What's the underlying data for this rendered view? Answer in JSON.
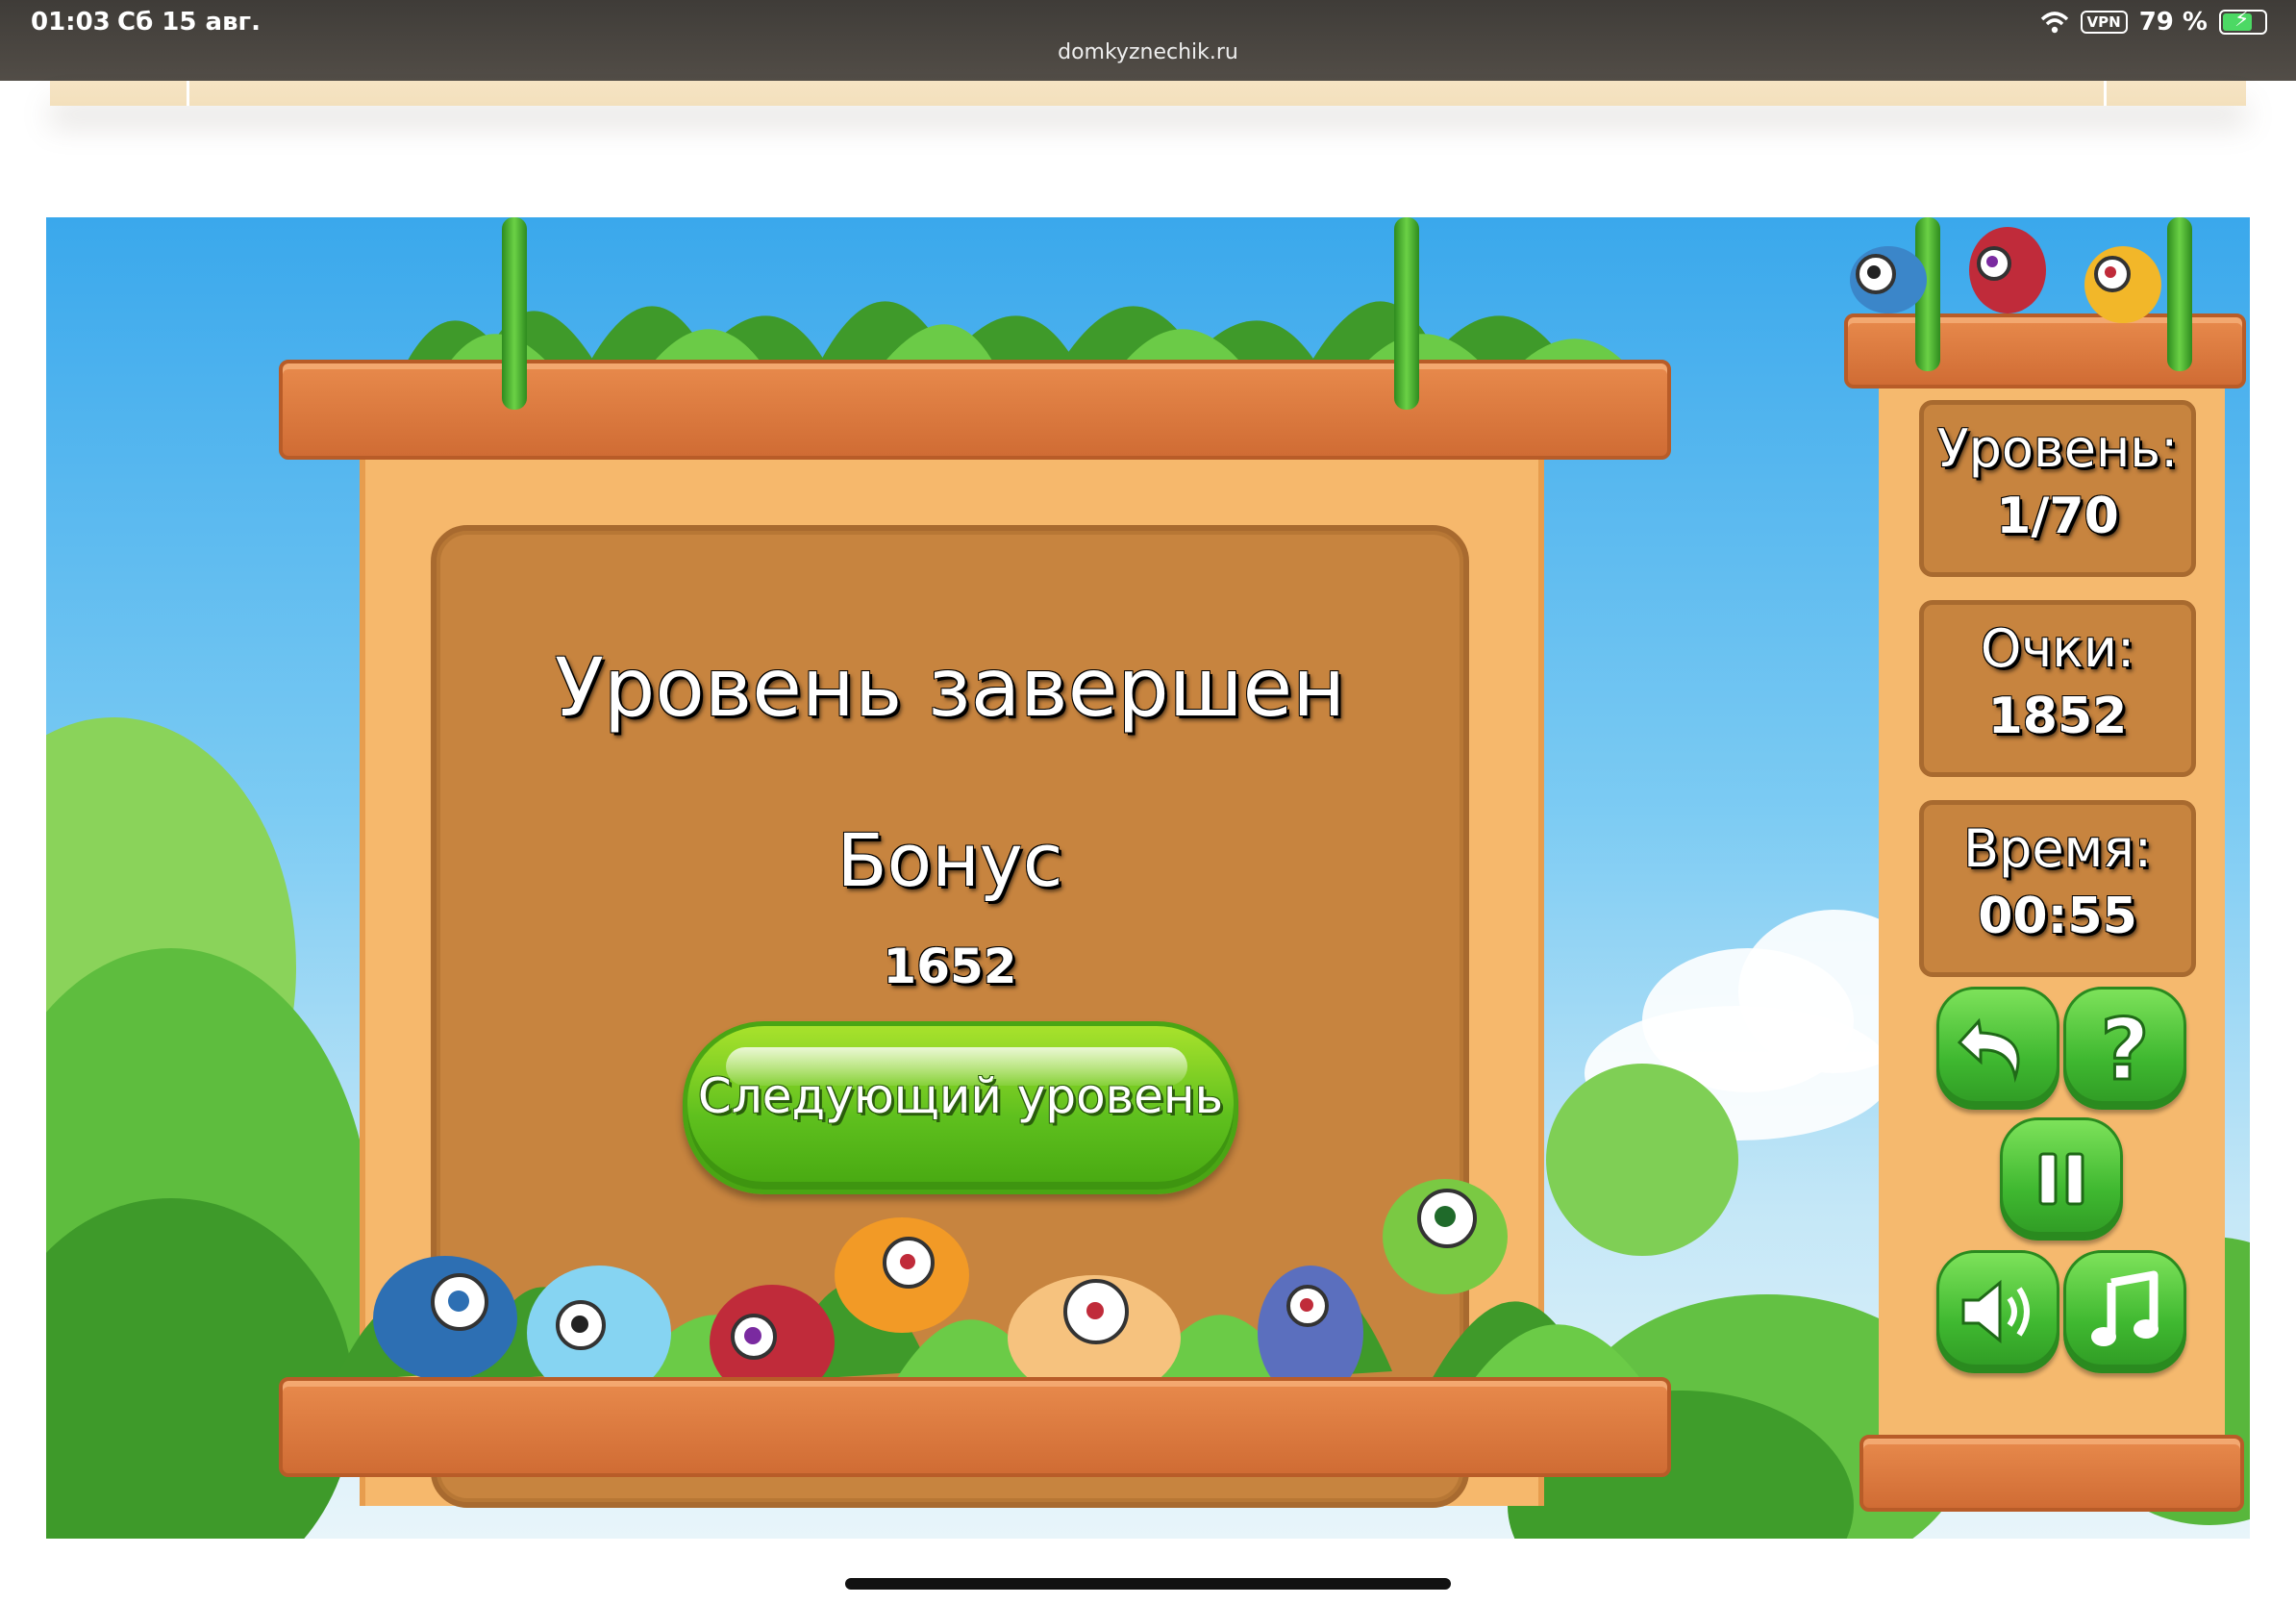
{
  "status_bar": {
    "time": "01:03",
    "date": "Сб 15 авг.",
    "url": "domkyznechik.ru",
    "vpn": "VPN",
    "battery": "79 %",
    "icons": [
      "wifi-icon",
      "battery-charging-icon"
    ]
  },
  "dialog": {
    "title": "Уровень завершен",
    "bonus_label": "Бонус",
    "bonus_value": "1652",
    "next_button": "Следующий уровень"
  },
  "panel": {
    "level_label": "Уровень:",
    "level_value": "1/70",
    "score_label": "Очки:",
    "score_value": "1852",
    "time_label": "Время:",
    "time_value": "00:55",
    "buttons": [
      "undo-icon",
      "help-icon",
      "pause-icon",
      "sound-icon",
      "music-icon"
    ]
  },
  "colors": {
    "button_green": "#5fc01e",
    "board_brown": "#c7843f",
    "plank_orange": "#e07a3e",
    "sky_blue": "#3aa8ec"
  }
}
